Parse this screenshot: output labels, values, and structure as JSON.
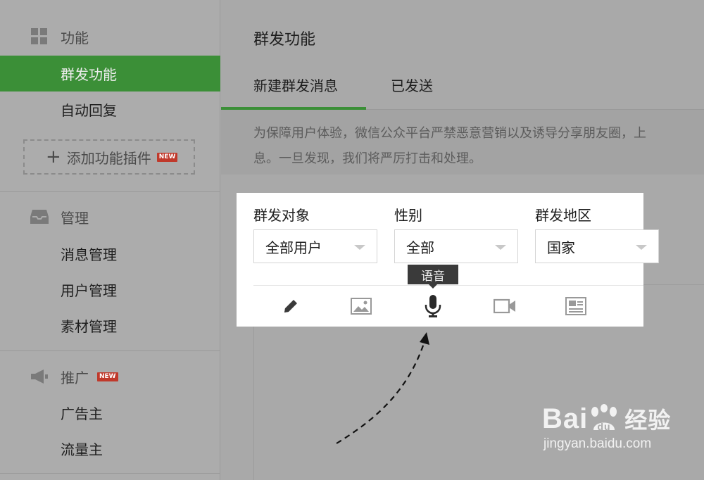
{
  "sidebar": {
    "function_section": {
      "title": "功能",
      "icon": "grid-icon"
    },
    "items_function": [
      {
        "label": "群发功能",
        "active": true
      },
      {
        "label": "自动回复",
        "active": false
      }
    ],
    "add_plugin": {
      "label": "添加功能插件",
      "badge": "NEW"
    },
    "manage_section": {
      "title": "管理",
      "icon": "inbox-icon"
    },
    "items_manage": [
      {
        "label": "消息管理"
      },
      {
        "label": "用户管理"
      },
      {
        "label": "素材管理"
      }
    ],
    "promote_section": {
      "title": "推广",
      "icon": "megaphone-icon",
      "badge": "NEW"
    },
    "items_promote": [
      {
        "label": "广告主"
      },
      {
        "label": "流量主"
      }
    ]
  },
  "main": {
    "title": "群发功能",
    "tabs": [
      {
        "label": "新建群发消息",
        "active": true
      },
      {
        "label": "已发送",
        "active": false
      }
    ],
    "notice_line1": "为保障用户体验，微信公众平台严禁恶意营销以及诱导分享朋友圈，上",
    "notice_line2": "息。一旦发现，我们将严厉打击和处理。",
    "filters": [
      {
        "label": "群发对象",
        "value": "全部用户"
      },
      {
        "label": "性别",
        "value": "全部"
      },
      {
        "label": "群发地区",
        "value": "国家"
      }
    ],
    "toolbar": {
      "tools": [
        "pencil-icon",
        "image-icon",
        "microphone-icon",
        "video-icon",
        "article-icon"
      ],
      "tooltip": "语音"
    }
  },
  "watermark": {
    "brand": "Bai",
    "brand_cn": "经验",
    "url": "jingyan.baidu.com"
  },
  "colors": {
    "accent": "#3b8f37",
    "badge": "#c0392b"
  }
}
